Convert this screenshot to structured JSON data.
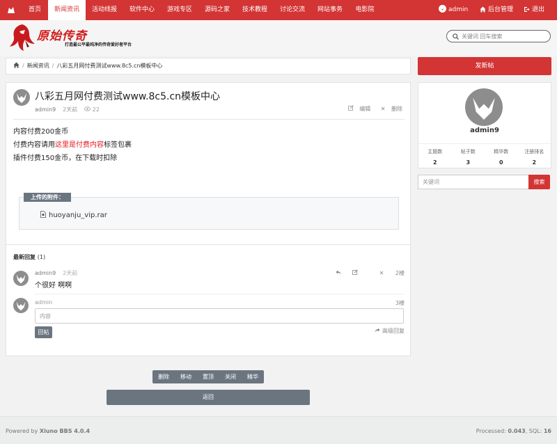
{
  "nav": {
    "items": [
      "首页",
      "新闻资讯",
      "活动线报",
      "软件中心",
      "游戏专区",
      "源码之家",
      "技术教程",
      "讨论交流",
      "网站事务",
      "电影院"
    ],
    "active_index": 1,
    "user": "admin",
    "admin_label": "后台管理",
    "logout_label": "退出"
  },
  "header": {
    "logo_text": "原始传奇",
    "slogan": "打造最公平最纯净的传奇爱好者平台",
    "search_placeholder": "关键词 回车搜索"
  },
  "breadcrumb": {
    "section": "新闻资讯",
    "current": "八彩五月网付费测试www.8c5.cn模板中心"
  },
  "post": {
    "title": "八彩五月网付费测试www.8c5.cn模板中心",
    "author": "admin9",
    "time": "2天前",
    "views": "22",
    "edit_label": "编辑",
    "delete_label": "删除",
    "content": {
      "line1": "内容付费200金币",
      "line2_prefix": "付费内容请用",
      "line2_highlight": "这里是付费内容",
      "line2_suffix": "标签包裹",
      "line3": "插件付费150金币，在下载时扣除"
    },
    "attachments_label": "上传的附件：",
    "attachment_file": "huoyanju_vip.rar"
  },
  "replies": {
    "title": "最新回复",
    "count": "(1)",
    "items": [
      {
        "author": "admin9",
        "time": "2天前",
        "text": "个很好  啊啊",
        "floor": "2楼"
      }
    ]
  },
  "compose": {
    "user": "admin",
    "floor": "3楼",
    "placeholder": "内容",
    "submit": "回帖",
    "advanced": "高级回复"
  },
  "moderation": [
    "删除",
    "移动",
    "置顶",
    "关闭",
    "精华"
  ],
  "back_label": "返回",
  "sidebar": {
    "new_post": "发新帖",
    "profile_name": "admin9",
    "stats": [
      {
        "label": "主题数",
        "value": "2"
      },
      {
        "label": "帖子数",
        "value": "3"
      },
      {
        "label": "精华数",
        "value": "0"
      },
      {
        "label": "注册排名",
        "value": "2"
      }
    ],
    "search_placeholder": "关键词",
    "search_button": "搜索"
  },
  "footer": {
    "left_prefix": "Powered by ",
    "left_bold": "Xiuno BBS 4.0.4",
    "processed_label": "Processed: ",
    "processed_value": "0.043",
    "sql_label": ", SQL: ",
    "sql_value": "16"
  },
  "colors": {
    "brand": "#d33434",
    "muted_button": "#6b7580",
    "paid_text": "#e3181d"
  }
}
